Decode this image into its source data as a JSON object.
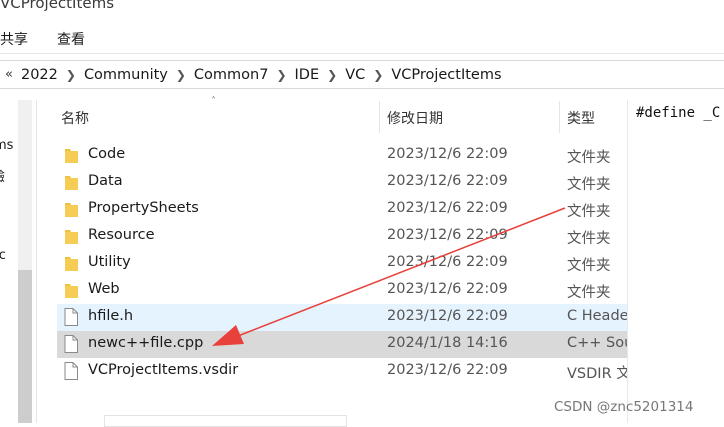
{
  "window": {
    "title": "VCProjectItems"
  },
  "menu": {
    "share": "共享",
    "view": "查看"
  },
  "address_bar": {
    "overflow": "«",
    "crumbs": [
      "2022",
      "Community",
      "Common7",
      "IDE",
      "VC",
      "VCProjectItems"
    ]
  },
  "nav_pane": {
    "items": [
      "ms",
      "驗",
      "sc"
    ]
  },
  "columns": {
    "name": "名称",
    "date": "修改日期",
    "type": "类型"
  },
  "files": [
    {
      "name": "Code",
      "date": "2023/12/6 22:09",
      "type": "文件夹",
      "kind": "folder"
    },
    {
      "name": "Data",
      "date": "2023/12/6 22:09",
      "type": "文件夹",
      "kind": "folder"
    },
    {
      "name": "PropertySheets",
      "date": "2023/12/6 22:09",
      "type": "文件夹",
      "kind": "folder"
    },
    {
      "name": "Resource",
      "date": "2023/12/6 22:09",
      "type": "文件夹",
      "kind": "folder"
    },
    {
      "name": "Utility",
      "date": "2023/12/6 22:09",
      "type": "文件夹",
      "kind": "folder"
    },
    {
      "name": "Web",
      "date": "2023/12/6 22:09",
      "type": "文件夹",
      "kind": "folder"
    },
    {
      "name": "hfile.h",
      "date": "2023/12/6 22:09",
      "type": "C Heade",
      "kind": "file"
    },
    {
      "name": "newc++file.cpp",
      "date": "2024/1/18 14:16",
      "type": "C++ Sou",
      "kind": "file"
    },
    {
      "name": "VCProjectItems.vsdir",
      "date": "2023/12/6 22:09",
      "type": "VSDIR 文",
      "kind": "file"
    }
  ],
  "preview": {
    "text": "#define _C"
  },
  "watermark": "CSDN @znc5201314",
  "colors": {
    "folder": "#f0c040",
    "arrow": "#e8403a",
    "selected_light": "#e5f3ff",
    "selected_gray": "#d9d9d9"
  }
}
